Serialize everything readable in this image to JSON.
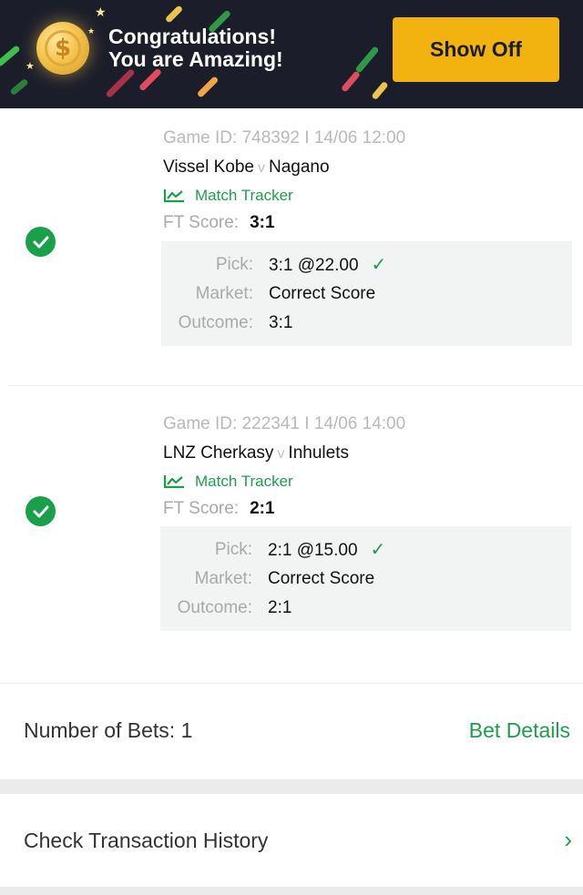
{
  "banner": {
    "line1": "Congratulations!",
    "line2": "You are Amazing!",
    "coin_symbol": "$",
    "show_off_label": "Show Off",
    "accent": "#f2b20f",
    "bg": "#1b1e2a"
  },
  "selections": [
    {
      "game_id": "Game ID: 748392 I 14/06 12:00",
      "home": "Vissel Kobe",
      "vs": "v",
      "away": "Nagano",
      "tracker_label": "Match Tracker",
      "ft_label": "FT Score:",
      "ft_value": "3:1",
      "pick_label": "Pick:",
      "pick_value": "3:1 @22.00",
      "market_label": "Market:",
      "market_value": "Correct Score",
      "outcome_label": "Outcome:",
      "outcome_value": "3:1",
      "status": "won"
    },
    {
      "game_id": "Game ID: 222341 I 14/06 14:00",
      "home": "LNZ Cherkasy",
      "vs": "v",
      "away": "Inhulets",
      "tracker_label": "Match Tracker",
      "ft_label": "FT Score:",
      "ft_value": "2:1",
      "pick_label": "Pick:",
      "pick_value": "2:1 @15.00",
      "market_label": "Market:",
      "market_value": "Correct Score",
      "outcome_label": "Outcome:",
      "outcome_value": "2:1",
      "status": "won"
    }
  ],
  "summary": {
    "bets_label": "Number of Bets: 1",
    "bet_details_label": "Bet Details"
  },
  "history": {
    "label": "Check Transaction History",
    "chevron_icon": "chevron-right-icon"
  },
  "colors": {
    "green": "#1f9d4e",
    "check_green": "#1aa04a"
  }
}
